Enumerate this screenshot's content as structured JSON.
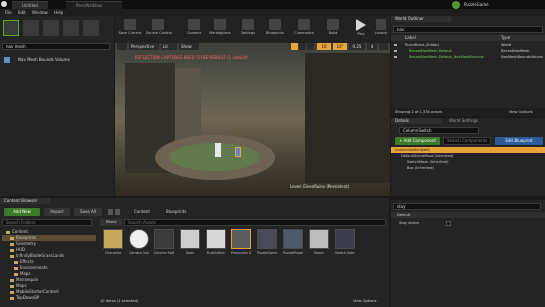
{
  "window": {
    "tabs": [
      "Untitled",
      "ParisWalkbox"
    ],
    "project_badge": "PuzzleGame",
    "menu": [
      "File",
      "Edit",
      "Window",
      "Help"
    ]
  },
  "modes": {
    "search_value": "nav mesh",
    "result_label": "Nav Mesh Bounds Volume"
  },
  "toolbar": {
    "buttons": [
      "Save Current",
      "Source Control",
      "Content",
      "Marketplace",
      "Settings",
      "Blueprints",
      "Cinematics",
      "Build",
      "Play",
      "Launch"
    ]
  },
  "viewport": {
    "perspective_label": "Perspective",
    "lit_label": "Lit",
    "show_label": "Show",
    "warning": "REFLECTION CAPTURES NEED TO BE REBUILT (1 unbuilt)",
    "grid_value": "10",
    "angle_value": "10°",
    "scale_value": "0.25",
    "camera_value": "4",
    "level_label": "Level:",
    "level_name": "ElvenRuins (Persistent)"
  },
  "outliner": {
    "title": "World Outliner",
    "search_value": "nav",
    "col_label": "Label",
    "col_type": "Type",
    "rows": [
      {
        "label": "ElvenRuins (Editor)",
        "type": "World"
      },
      {
        "label": "RecastNavMesh-Default",
        "type": "RecastNavMesh"
      },
      {
        "label": "RecastNavMesh-Default_NavMeshBounds",
        "type": "NavMeshBoundsVolume"
      }
    ],
    "footer": "Showing 2 of 1,378 actors",
    "view_options": "View Options"
  },
  "details": {
    "tab_details": "Details",
    "tab_world": "World Settings",
    "actor_name": "ColumnSwitch",
    "add_component": "+ Add Component",
    "search_placeholder": "Search Components",
    "edit_blueprint": "Edit Blueprint",
    "component_root": "ColumnSwitch(self)",
    "components": [
      "DefaultSceneRoot (Inherited)",
      "SwitchMesh (Inherited)",
      "Box (Inherited)"
    ],
    "filter_value": "stay",
    "section_default": "Default",
    "prop_stay_active": "Stay Active"
  },
  "content_browser": {
    "title": "Content Browser",
    "add_new": "Add New",
    "import": "Import",
    "save_all": "Save All",
    "path_root": "Content",
    "path_leaf": "Blueprints",
    "search_folders": "Search Folders",
    "search_assets": "Search Assets",
    "filters": "Filters",
    "folders": [
      "Content",
      "Blueprints",
      "Geometry",
      "HUD",
      "InfinityBladeGrassLands",
      "Effects",
      "Environments",
      "Maps",
      "Mannequin",
      "Maps",
      "MobileStarterContent",
      "TopDownBP"
    ],
    "assets": [
      "Character",
      "Camera Volume",
      "Column Switch",
      "Door",
      "FinalSwitch",
      "Pressurize Door",
      "PuzzleGame Mode",
      "PuzzlePlayer Controller",
      "Room",
      "Switch Interface"
    ],
    "footer": "10 items (1 selected)",
    "view_options": "View Options",
    "collapse": "Collapse"
  },
  "colors": {
    "accent": "#3d7a2a",
    "blue": "#2a5c9a",
    "selection": "#e8a33a",
    "highlight": "#5ea032"
  }
}
